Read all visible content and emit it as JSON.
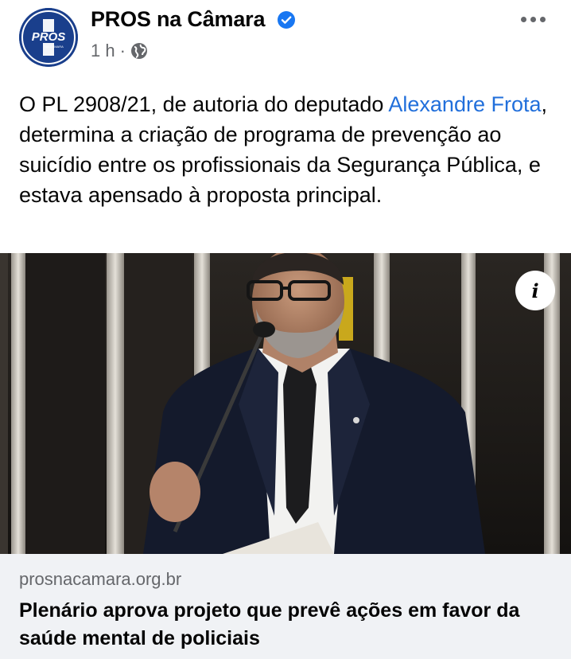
{
  "header": {
    "page_name": "PROS na Câmara",
    "avatar_text": "PROS",
    "avatar_subtext": "NA CÂMARA",
    "time": "1 h",
    "separator": "·",
    "verified_icon": "verified-badge-icon",
    "privacy_icon": "globe-icon",
    "more_icon": "more-options-icon"
  },
  "post": {
    "text_before_link": "O PL 2908/21, de autoria do deputado ",
    "link_text": "Alexandre Frota",
    "text_after_link": ", determina a criação de programa de prevenção ao suicídio entre os profissionais da Segurança Pública, e estava apensado à proposta principal."
  },
  "photo": {
    "info_label": "i"
  },
  "link_preview": {
    "domain": "prosnacamara.org.br",
    "title": "Plenário aprova projeto que prevê ações em favor da saúde mental de policiais"
  },
  "colors": {
    "link": "#216fdb",
    "verified": "#1877f2",
    "secondary_text": "#65676b",
    "preview_bg": "#f0f2f5",
    "avatar_bg": "#1a3f8c"
  }
}
